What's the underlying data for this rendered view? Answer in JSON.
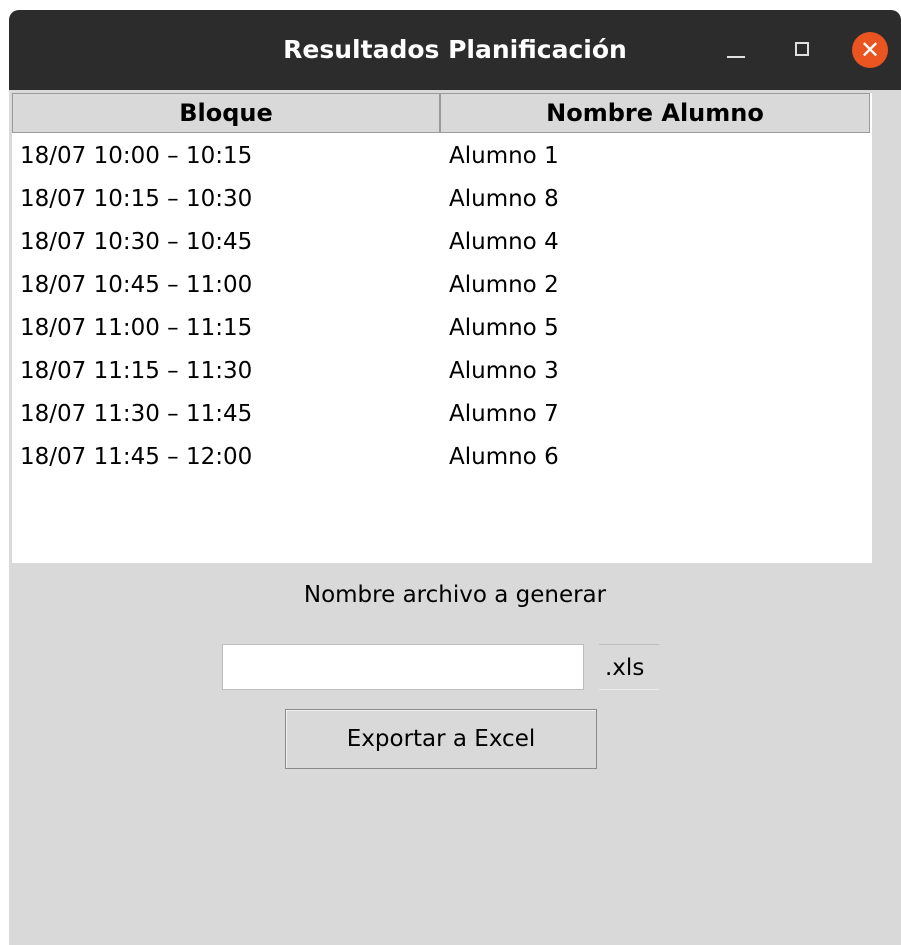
{
  "window": {
    "title": "Resultados Planificación",
    "controls": {
      "minimize": "minimize-icon",
      "maximize": "maximize-icon",
      "close": "close-icon",
      "close_color": "#e95420"
    }
  },
  "table": {
    "headers": [
      "Bloque",
      "Nombre Alumno"
    ],
    "rows": [
      {
        "bloque": "18/07 10:00 – 10:15",
        "alumno": "Alumno 1"
      },
      {
        "bloque": "18/07 10:15 – 10:30",
        "alumno": "Alumno 8"
      },
      {
        "bloque": "18/07 10:30 – 10:45",
        "alumno": "Alumno 4"
      },
      {
        "bloque": "18/07 10:45 – 11:00",
        "alumno": "Alumno 2"
      },
      {
        "bloque": "18/07 11:00 – 11:15",
        "alumno": "Alumno 5"
      },
      {
        "bloque": "18/07 11:15 – 11:30",
        "alumno": "Alumno 3"
      },
      {
        "bloque": "18/07 11:30 – 11:45",
        "alumno": "Alumno 7"
      },
      {
        "bloque": "18/07 11:45 – 12:00",
        "alumno": "Alumno 6"
      }
    ]
  },
  "export": {
    "label": "Nombre archivo a generar",
    "filename_value": "",
    "suffix": ".xls",
    "button_label": "Exportar a Excel"
  }
}
